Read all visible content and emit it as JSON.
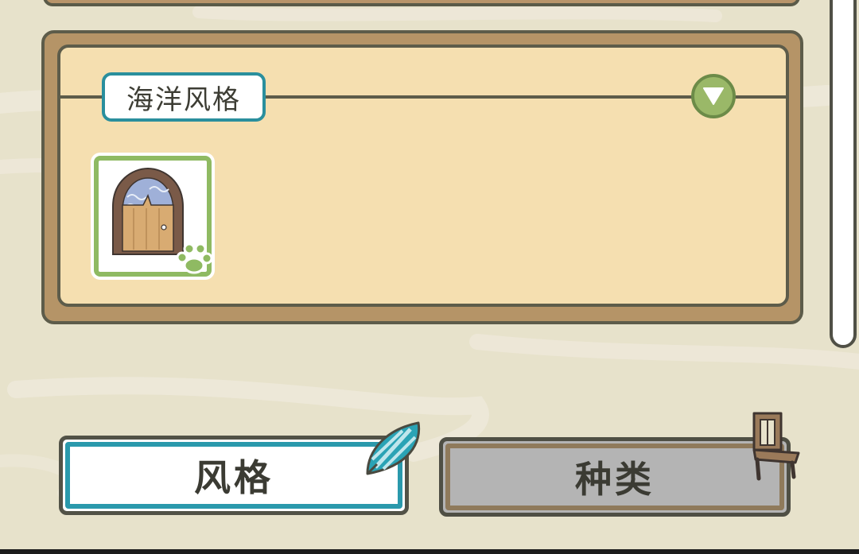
{
  "category_section": {
    "title": "海洋风格",
    "items": [
      {
        "icon": "arched-door-icon",
        "owned_marker": "green-paw-icon"
      }
    ]
  },
  "tabs": {
    "style_label": "风格",
    "category_label": "种类",
    "active": "风格"
  },
  "colors": {
    "background": "#e7e2cb",
    "panel_wood": "#b59467",
    "panel_paper": "#f5dfb0",
    "active_tab_border": "#2a99ac",
    "inactive_tab_fill": "#b4b4b4",
    "frame_green": "#8fba62"
  },
  "icons": {
    "collapse": "chevron-down-icon",
    "style_tab": "seashell-icon",
    "category_tab": "chair-icon"
  }
}
